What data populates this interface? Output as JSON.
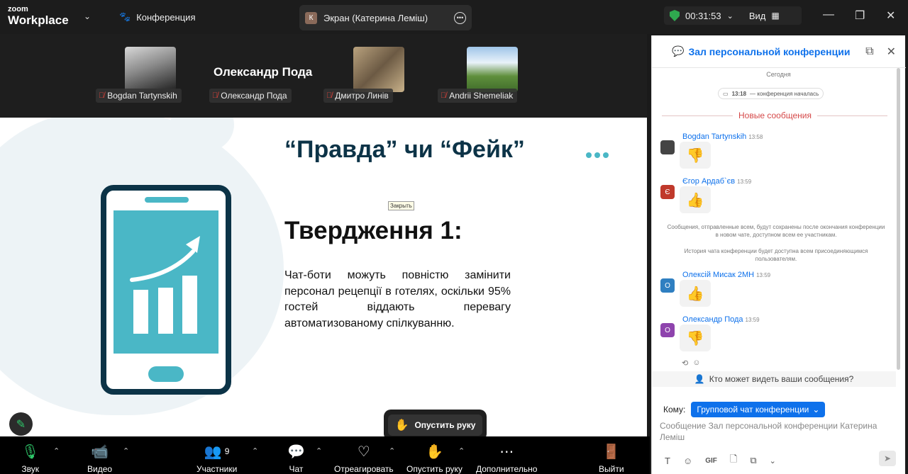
{
  "topbar": {
    "logo_small": "zoom",
    "logo_big": "Workplace",
    "conference_label": "Конференция",
    "screen_badge": "К",
    "screen_label": "Экран (Катерина Леміш)",
    "timer": "00:31:53",
    "view_label": "Вид"
  },
  "participants": {
    "tiles": [
      {
        "name": "Bogdan Tartynskih"
      },
      {
        "name": "Олександр Пода"
      },
      {
        "name": "Дмитро Линів"
      },
      {
        "name": "Andrii Shemeliak"
      }
    ],
    "active_speaker": "Олександр Пода"
  },
  "slide": {
    "title": "“Правда” чи “Фейк”",
    "tooltip": "Закрыть",
    "heading": "Твердження 1:",
    "text": "Чат-боти можуть повністю замінити персонал рецепції в готелях, оскільки 95% гостей віддають перевагу автоматизованому спілкуванню."
  },
  "lower_hand": {
    "label": "Опустить руку"
  },
  "toolbar": {
    "audio": "Звук",
    "video": "Видео",
    "participants": "Участники",
    "participants_count": "9",
    "chat": "Чат",
    "react": "Отреагировать",
    "lower_hand": "Опустить руку",
    "more": "Дополнительно",
    "leave": "Выйти"
  },
  "chat": {
    "title": "Зал персональной конференции ...",
    "today": "Сегодня",
    "started_time": "13:18",
    "started_text": "— конференция началась",
    "new_messages": "Новые сообщения",
    "messages": [
      {
        "name": "Bogdan Tartynskih",
        "time": "13:58",
        "emoji": "👎",
        "avatar": ""
      },
      {
        "name": "Єгор Ардаб`єв",
        "time": "13:59",
        "emoji": "👍",
        "avatar": "Є"
      },
      {
        "name": "Олексій Мисак 2МН",
        "time": "13:59",
        "emoji": "👍",
        "avatar": "О"
      },
      {
        "name": "Олександр Пода",
        "time": "13:59",
        "emoji": "👎",
        "avatar": "О"
      }
    ],
    "system_1": "Сообщения, отправленные всем, будут сохранены после окончания конференции в новом чате, доступном всем ее участникам.",
    "system_2": "История чата конференции будет доступна всем присоединяющимся пользователям.",
    "who_can_see": "Кто может видеть ваши сообщения?",
    "to_label": "Кому:",
    "to_value": "Групповой чат конференции",
    "input_placeholder": "Сообщение Зал персональной конференции Катерина Леміш",
    "gif_label": "GIF"
  },
  "colors": {
    "accent": "#0e71eb",
    "slide_teal": "#4ab7c6",
    "slide_navy": "#0c3347",
    "mute_red": "#e0433a"
  }
}
